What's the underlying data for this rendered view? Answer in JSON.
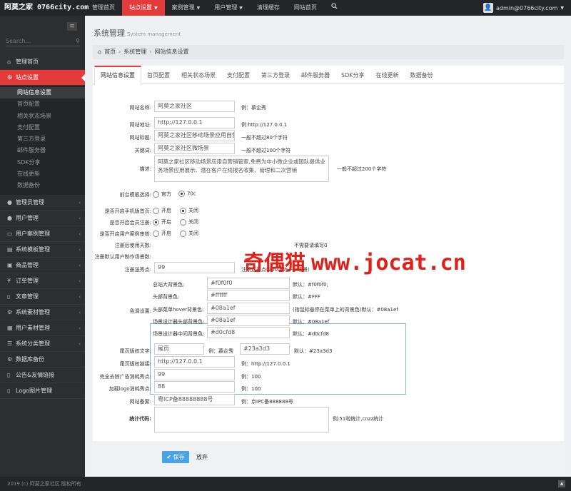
{
  "logo": "阿莫之家 0766city.com",
  "nav": [
    "管理首页",
    "站点设置",
    "案例管理",
    "用户管理",
    "清理缓存",
    "网站首页"
  ],
  "user": "admin@0766city.com",
  "sidebar": {
    "search_placeholder": "Search...",
    "items": [
      "管理首页",
      "站点设置",
      "管理员管理",
      "用户管理",
      "用户案例管理",
      "系统模板管理",
      "商品管理",
      "订单管理",
      "文章管理",
      "系统素材管理",
      "用户素材管理",
      "系统分类管理",
      "数据库备份",
      "公告&友情链接",
      "Logo图片管理"
    ],
    "submenu": [
      "网站信息设置",
      "首页配置",
      "相关状态场景",
      "支付配置",
      "第三方登录",
      "邮件服务器",
      "SDK分享",
      "在线更新",
      "数据备份"
    ]
  },
  "page_title": "系统管理",
  "page_subtitle": "System management",
  "breadcrumb": [
    "首页",
    "系统管理",
    "网站信息设置"
  ],
  "tabs": [
    "网站信息设置",
    "首页配置",
    "相关状态场景",
    "支付配置",
    "第三方登录",
    "邮件服务器",
    "SDK分享",
    "在线更新",
    "数据备份"
  ],
  "form": {
    "site_name": {
      "label": "网站名称:",
      "value": "阿莫之家社区",
      "hint": "例：慕企秀"
    },
    "site_url": {
      "label": "网站地址:",
      "value": "http://127.0.0.1",
      "hint": "例:http://127.0.0.1"
    },
    "site_title": {
      "label": "网站标题:",
      "value": "阿莫之家社区移动场景应用自营销",
      "hint": "一般不超过80个字符"
    },
    "keywords": {
      "label": "关键词:",
      "value": "阿莫之家社区微场景",
      "hint": "一般不超过100个字符"
    },
    "description": {
      "label": "描述:",
      "value": "阿莫之家社区移动场景应用自营销管家,免费为中小微企业或团队提供业务场景应用展示、潜在客户在线报名收集、管理和二次营销",
      "hint": "一般不超过200个字符"
    },
    "template": {
      "label": "前台模板选择:",
      "options": [
        "官方",
        "70c"
      ]
    },
    "mobile_home": {
      "label": "是否开启手机版首页:",
      "options": [
        "开启",
        "关闭"
      ]
    },
    "member_reg": {
      "label": "是否开启会员注册:",
      "options": [
        "开启",
        "关闭"
      ]
    },
    "case_review": {
      "label": "是否开启用户案例审核:",
      "options": [
        "开启",
        "关闭"
      ]
    },
    "days_label": "注册后使用天数:",
    "days_hint": "不需要请填写0",
    "default_count_label": "注册默认用户制作场景数:",
    "points": {
      "label": "注册送秀点:",
      "value": "99",
      "hint": "注册送秀点(200点为一个场景)"
    },
    "color_label": "色调设置:",
    "colors": [
      {
        "label": "总站大背景色:",
        "value": "#f0f0f0",
        "hint": "默认：#f0f0f0;"
      },
      {
        "label": "头部背景色:",
        "value": "#ffffff",
        "hint": "默认：#FFF"
      },
      {
        "label": "头部菜单hover背景色:",
        "value": "#08a1ef",
        "hint": "(指鼠标悬停在菜单上的背景色)默认：#08a1ef"
      },
      {
        "label": "场景设计器头部背景色:",
        "value": "#08a1ef",
        "hint": "默认：#08a1ef"
      },
      {
        "label": "场景设计器中间背景色:",
        "value": "#d0cfd8",
        "hint": "默认：#d0cfd8"
      }
    ],
    "footer_text": {
      "label": "尾页版权文字:",
      "value": "尾页",
      "hint": "例：慕企秀",
      "color_value": "#23a3d3",
      "color_hint": "默认：#23a3d3"
    },
    "footer_link": {
      "label": "尾页版权链接:",
      "value": "http://127.0.0.1",
      "hint": "例：http://127.0.0.1"
    },
    "ad_points": {
      "label": "完全去除广告消耗秀点:",
      "value": "99",
      "hint": "例：100"
    },
    "logo_points": {
      "label": "加载logo消耗秀点:",
      "value": "88",
      "hint": "例：100"
    },
    "icp": {
      "label": "网站备案:",
      "value": "粤ICP备88888888号",
      "hint": "例：京IPC备888888号"
    },
    "stats": {
      "label": "统计代码:",
      "hint": "例:51啦统计,cnzz统计"
    }
  },
  "save_label": "保存",
  "cancel_label": "放弃",
  "footer": "2019 (c) 阿莫之家社区 版权所有",
  "watermark": {
    "cn": "奇偶猫",
    "url": "www.jocat.cn"
  },
  "colors": {
    "accent": "#e53a3a",
    "topbar": "#232527",
    "sidebar": "#2c2e30",
    "primary_button": "#4aa4e4"
  }
}
